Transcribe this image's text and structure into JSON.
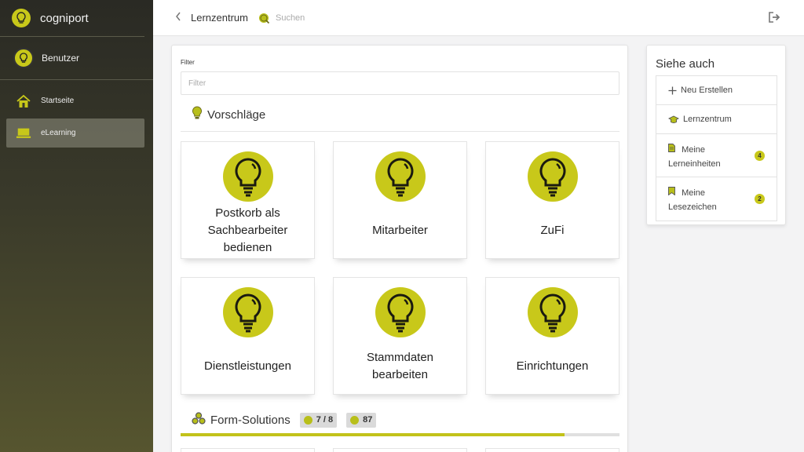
{
  "app": {
    "brand": "cogniport"
  },
  "colors": {
    "accent": "#c8c81a",
    "sidebar_top": "#2a2a24",
    "sidebar_bottom": "#56552f"
  },
  "sidebar": {
    "user": "Benutzer",
    "items": [
      {
        "label": "Startseite",
        "icon": "home-icon",
        "active": false
      },
      {
        "label": "eLearning",
        "icon": "laptop-icon",
        "active": true
      }
    ]
  },
  "topbar": {
    "back_icon": "chevron-left-icon",
    "title": "Lernzentrum",
    "search_placeholder": "Suchen",
    "logout_icon": "logout-icon"
  },
  "filter": {
    "label": "Filter",
    "placeholder": "Filter",
    "value": ""
  },
  "suggestions": {
    "heading": "Vorschläge",
    "icon": "lightbulb-icon",
    "tiles": [
      {
        "label": "Postkorb als Sachbearbeiter bedienen"
      },
      {
        "label": "Mitarbeiter"
      },
      {
        "label": "ZuFi"
      },
      {
        "label": "Dienstleistungen"
      },
      {
        "label": "Stammdaten bearbeiten"
      },
      {
        "label": "Einrichtungen"
      }
    ]
  },
  "form_solutions": {
    "heading": "Form-Solutions",
    "icon": "cubes-icon",
    "progress_badge": "7 / 8",
    "score_badge": "87",
    "progress": 0.875
  },
  "see_also": {
    "heading": "Siehe auch",
    "items": [
      {
        "label": "Neu Erstellen",
        "icon": "plus-icon"
      },
      {
        "label": "Lernzentrum",
        "icon": "graduation-cap-icon"
      },
      {
        "label": "Meine Lerneinheiten",
        "icon": "document-icon",
        "count": "4"
      },
      {
        "label": "Meine Lesezeichen",
        "icon": "bookmark-icon",
        "count": "2"
      }
    ]
  }
}
